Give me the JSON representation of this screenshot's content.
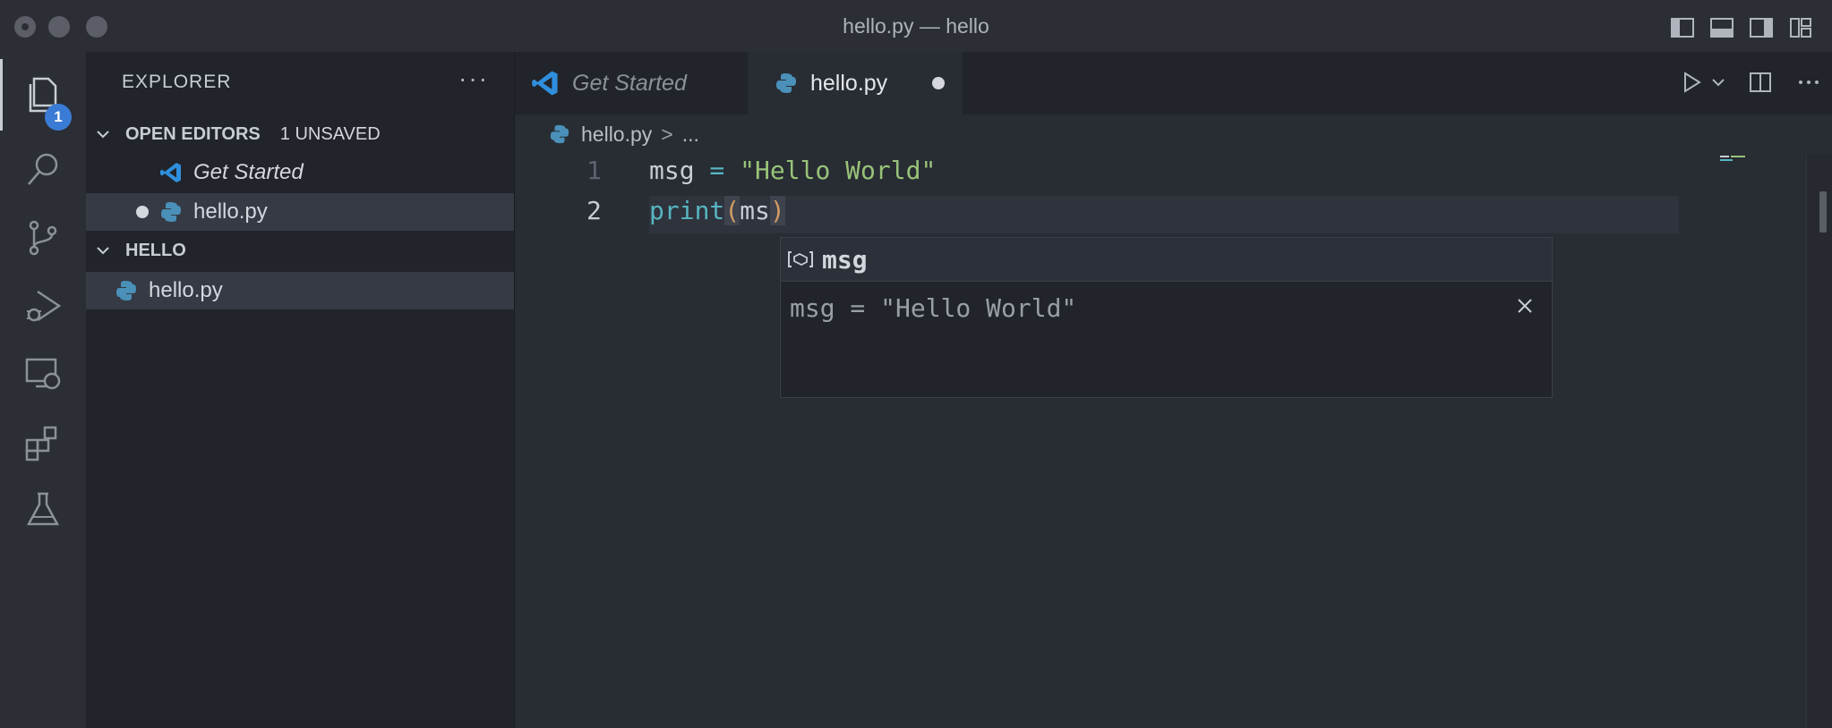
{
  "window": {
    "title": "hello.py — hello"
  },
  "activity_bar": {
    "items": [
      {
        "name": "explorer",
        "icon": "files-icon",
        "badge": "1",
        "active": true
      },
      {
        "name": "search",
        "icon": "search-icon"
      },
      {
        "name": "source-control",
        "icon": "source-control-icon"
      },
      {
        "name": "run-debug",
        "icon": "run-debug-icon"
      },
      {
        "name": "remote-explorer",
        "icon": "remote-explorer-icon"
      },
      {
        "name": "extensions",
        "icon": "extensions-icon"
      },
      {
        "name": "testing",
        "icon": "flask-icon"
      }
    ]
  },
  "sidebar": {
    "title": "EXPLORER",
    "more_label": "···",
    "open_editors": {
      "title": "OPEN EDITORS",
      "unsaved": "1 UNSAVED",
      "items": [
        {
          "label": "Get Started",
          "icon": "vscode-logo-icon",
          "italic": true
        },
        {
          "label": "hello.py",
          "icon": "python-icon",
          "dirty": true,
          "selected": true
        }
      ]
    },
    "folder": {
      "title": "HELLO",
      "items": [
        {
          "label": "hello.py",
          "icon": "python-icon",
          "selected": true
        }
      ]
    }
  },
  "tabs": [
    {
      "label": "Get Started",
      "icon": "vscode-logo-icon",
      "active": false
    },
    {
      "label": "hello.py",
      "icon": "python-icon",
      "active": true,
      "dirty": true
    }
  ],
  "breadcrumb": {
    "file": "hello.py",
    "sep": ">",
    "rest": "..."
  },
  "editor": {
    "lines": [
      {
        "num": "1",
        "tokens": [
          "msg",
          " = ",
          "\"Hello World\""
        ]
      },
      {
        "num": "2",
        "tokens": [
          "print",
          "(",
          "ms",
          ")"
        ]
      }
    ],
    "current_line": 2
  },
  "hover": {
    "symbol": "msg",
    "symbol_icon": "variable-icon",
    "detail": "msg = \"Hello World\""
  },
  "colors": {
    "background": "#24272e",
    "editor": "#282c33",
    "sidebar": "#21242a",
    "string": "#98c379",
    "keyword_op": "#56b6c2",
    "paren": "#d19a66",
    "badge": "#3a7bd5"
  }
}
